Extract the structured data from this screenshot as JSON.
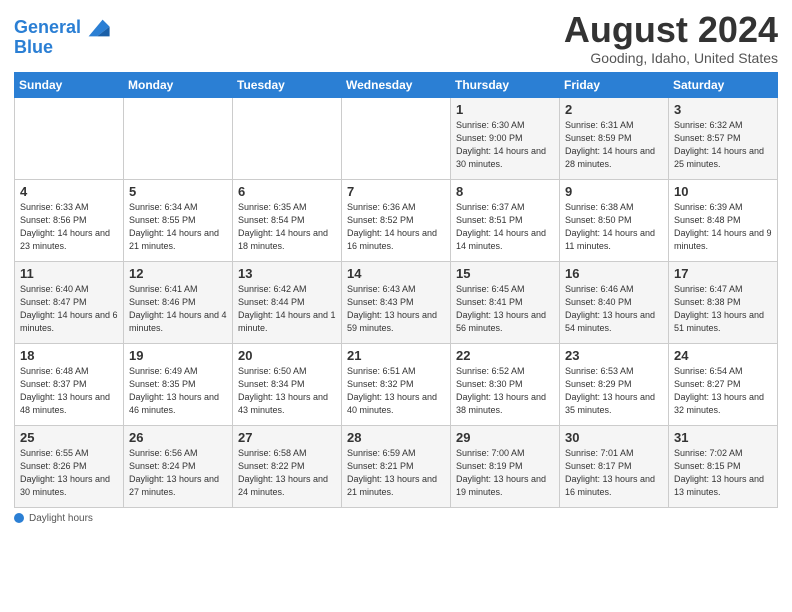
{
  "header": {
    "logo_line1": "General",
    "logo_line2": "Blue",
    "title": "August 2024",
    "subtitle": "Gooding, Idaho, United States"
  },
  "footer": {
    "label": "Daylight hours"
  },
  "weekdays": [
    "Sunday",
    "Monday",
    "Tuesday",
    "Wednesday",
    "Thursday",
    "Friday",
    "Saturday"
  ],
  "weeks": [
    [
      {
        "num": "",
        "info": ""
      },
      {
        "num": "",
        "info": ""
      },
      {
        "num": "",
        "info": ""
      },
      {
        "num": "",
        "info": ""
      },
      {
        "num": "1",
        "info": "Sunrise: 6:30 AM\nSunset: 9:00 PM\nDaylight: 14 hours and 30 minutes."
      },
      {
        "num": "2",
        "info": "Sunrise: 6:31 AM\nSunset: 8:59 PM\nDaylight: 14 hours and 28 minutes."
      },
      {
        "num": "3",
        "info": "Sunrise: 6:32 AM\nSunset: 8:57 PM\nDaylight: 14 hours and 25 minutes."
      }
    ],
    [
      {
        "num": "4",
        "info": "Sunrise: 6:33 AM\nSunset: 8:56 PM\nDaylight: 14 hours and 23 minutes."
      },
      {
        "num": "5",
        "info": "Sunrise: 6:34 AM\nSunset: 8:55 PM\nDaylight: 14 hours and 21 minutes."
      },
      {
        "num": "6",
        "info": "Sunrise: 6:35 AM\nSunset: 8:54 PM\nDaylight: 14 hours and 18 minutes."
      },
      {
        "num": "7",
        "info": "Sunrise: 6:36 AM\nSunset: 8:52 PM\nDaylight: 14 hours and 16 minutes."
      },
      {
        "num": "8",
        "info": "Sunrise: 6:37 AM\nSunset: 8:51 PM\nDaylight: 14 hours and 14 minutes."
      },
      {
        "num": "9",
        "info": "Sunrise: 6:38 AM\nSunset: 8:50 PM\nDaylight: 14 hours and 11 minutes."
      },
      {
        "num": "10",
        "info": "Sunrise: 6:39 AM\nSunset: 8:48 PM\nDaylight: 14 hours and 9 minutes."
      }
    ],
    [
      {
        "num": "11",
        "info": "Sunrise: 6:40 AM\nSunset: 8:47 PM\nDaylight: 14 hours and 6 minutes."
      },
      {
        "num": "12",
        "info": "Sunrise: 6:41 AM\nSunset: 8:46 PM\nDaylight: 14 hours and 4 minutes."
      },
      {
        "num": "13",
        "info": "Sunrise: 6:42 AM\nSunset: 8:44 PM\nDaylight: 14 hours and 1 minute."
      },
      {
        "num": "14",
        "info": "Sunrise: 6:43 AM\nSunset: 8:43 PM\nDaylight: 13 hours and 59 minutes."
      },
      {
        "num": "15",
        "info": "Sunrise: 6:45 AM\nSunset: 8:41 PM\nDaylight: 13 hours and 56 minutes."
      },
      {
        "num": "16",
        "info": "Sunrise: 6:46 AM\nSunset: 8:40 PM\nDaylight: 13 hours and 54 minutes."
      },
      {
        "num": "17",
        "info": "Sunrise: 6:47 AM\nSunset: 8:38 PM\nDaylight: 13 hours and 51 minutes."
      }
    ],
    [
      {
        "num": "18",
        "info": "Sunrise: 6:48 AM\nSunset: 8:37 PM\nDaylight: 13 hours and 48 minutes."
      },
      {
        "num": "19",
        "info": "Sunrise: 6:49 AM\nSunset: 8:35 PM\nDaylight: 13 hours and 46 minutes."
      },
      {
        "num": "20",
        "info": "Sunrise: 6:50 AM\nSunset: 8:34 PM\nDaylight: 13 hours and 43 minutes."
      },
      {
        "num": "21",
        "info": "Sunrise: 6:51 AM\nSunset: 8:32 PM\nDaylight: 13 hours and 40 minutes."
      },
      {
        "num": "22",
        "info": "Sunrise: 6:52 AM\nSunset: 8:30 PM\nDaylight: 13 hours and 38 minutes."
      },
      {
        "num": "23",
        "info": "Sunrise: 6:53 AM\nSunset: 8:29 PM\nDaylight: 13 hours and 35 minutes."
      },
      {
        "num": "24",
        "info": "Sunrise: 6:54 AM\nSunset: 8:27 PM\nDaylight: 13 hours and 32 minutes."
      }
    ],
    [
      {
        "num": "25",
        "info": "Sunrise: 6:55 AM\nSunset: 8:26 PM\nDaylight: 13 hours and 30 minutes."
      },
      {
        "num": "26",
        "info": "Sunrise: 6:56 AM\nSunset: 8:24 PM\nDaylight: 13 hours and 27 minutes."
      },
      {
        "num": "27",
        "info": "Sunrise: 6:58 AM\nSunset: 8:22 PM\nDaylight: 13 hours and 24 minutes."
      },
      {
        "num": "28",
        "info": "Sunrise: 6:59 AM\nSunset: 8:21 PM\nDaylight: 13 hours and 21 minutes."
      },
      {
        "num": "29",
        "info": "Sunrise: 7:00 AM\nSunset: 8:19 PM\nDaylight: 13 hours and 19 minutes."
      },
      {
        "num": "30",
        "info": "Sunrise: 7:01 AM\nSunset: 8:17 PM\nDaylight: 13 hours and 16 minutes."
      },
      {
        "num": "31",
        "info": "Sunrise: 7:02 AM\nSunset: 8:15 PM\nDaylight: 13 hours and 13 minutes."
      }
    ]
  ]
}
